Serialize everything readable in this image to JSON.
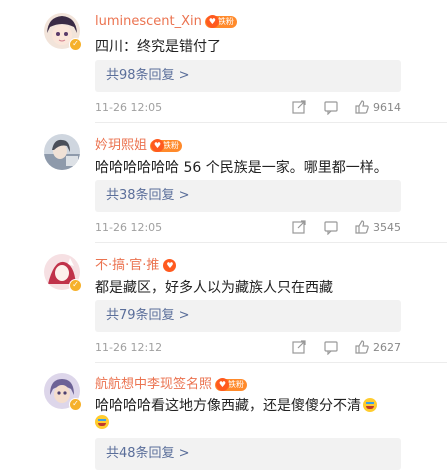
{
  "comments": [
    {
      "username": "luminescent_Xin",
      "badge": "铁粉",
      "text": "四川：终究是错付了",
      "emoji": false,
      "replies_label": "共98条回复 >",
      "time": "11-26 12:05",
      "likes": "9614",
      "avatar_colors": [
        "#f4e1d7",
        "#3a2b45",
        "#e8a1b0"
      ]
    },
    {
      "username": "妗玥熙姐",
      "badge": "铁粉",
      "text": "哈哈哈哈哈哈 56 个民族是一家。哪里都一样。",
      "emoji": false,
      "replies_label": "共38条回复 >",
      "time": "11-26 12:05",
      "likes": "3545",
      "avatar_colors": [
        "#cfd6df",
        "#5a5f6a",
        "#9fb3c9"
      ]
    },
    {
      "username": "不·搞·官·推",
      "badge": "",
      "text": "都是藏区，好多人以为藏族人只在西藏",
      "emoji": false,
      "replies_label": "共79条回复 >",
      "time": "11-26 12:12",
      "likes": "2627",
      "avatar_colors": [
        "#f3d3d8",
        "#c0324a",
        "#ffffff"
      ]
    },
    {
      "username": "航航想中李现签名照",
      "badge": "铁粉",
      "text": "哈哈哈哈看这地方像西藏，还是傻傻分不清",
      "emoji": true,
      "replies_label": "共48条回复 >",
      "time": "",
      "likes": "",
      "avatar_colors": [
        "#d9d4e6",
        "#7b6fa0",
        "#e9c3a4"
      ]
    }
  ],
  "icons": {
    "share": "share-icon",
    "comment": "comment-icon",
    "like": "like-icon",
    "verified": "verified-badge-icon",
    "fan_heart": "heart-icon"
  },
  "colors": {
    "username": "#eb7350",
    "reply_link": "#5a6e9a",
    "badge": "#ff8a2b"
  }
}
